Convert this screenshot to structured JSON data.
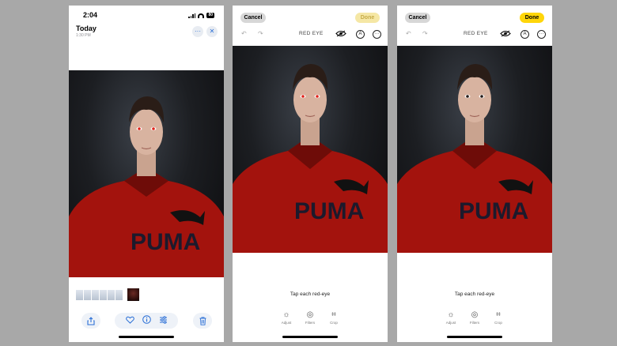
{
  "panel1": {
    "status": {
      "time": "2:04",
      "battery": "80"
    },
    "header": {
      "title": "Today",
      "subtitle": "1:30 PM"
    },
    "shirt_text": "PUMA"
  },
  "panel2": {
    "cancel_label": "Cancel",
    "done_label": "Done",
    "mode_label": "RED EYE",
    "hint": "Tap each red-eye",
    "tools": [
      "Adjust",
      "Filters",
      "Crop"
    ],
    "shirt_text": "PUMA"
  },
  "panel3": {
    "cancel_label": "Cancel",
    "done_label": "Done",
    "mode_label": "RED EYE",
    "hint": "Tap each red-eye",
    "tools": [
      "Adjust",
      "Filters",
      "Crop"
    ],
    "shirt_text": "PUMA"
  },
  "colors": {
    "accent": "#2a6fd6",
    "done_active": "#ffd60a",
    "done_inactive": "#f5e7a5",
    "hoodie": "#b3150f",
    "red_eye": "#e0231a"
  }
}
